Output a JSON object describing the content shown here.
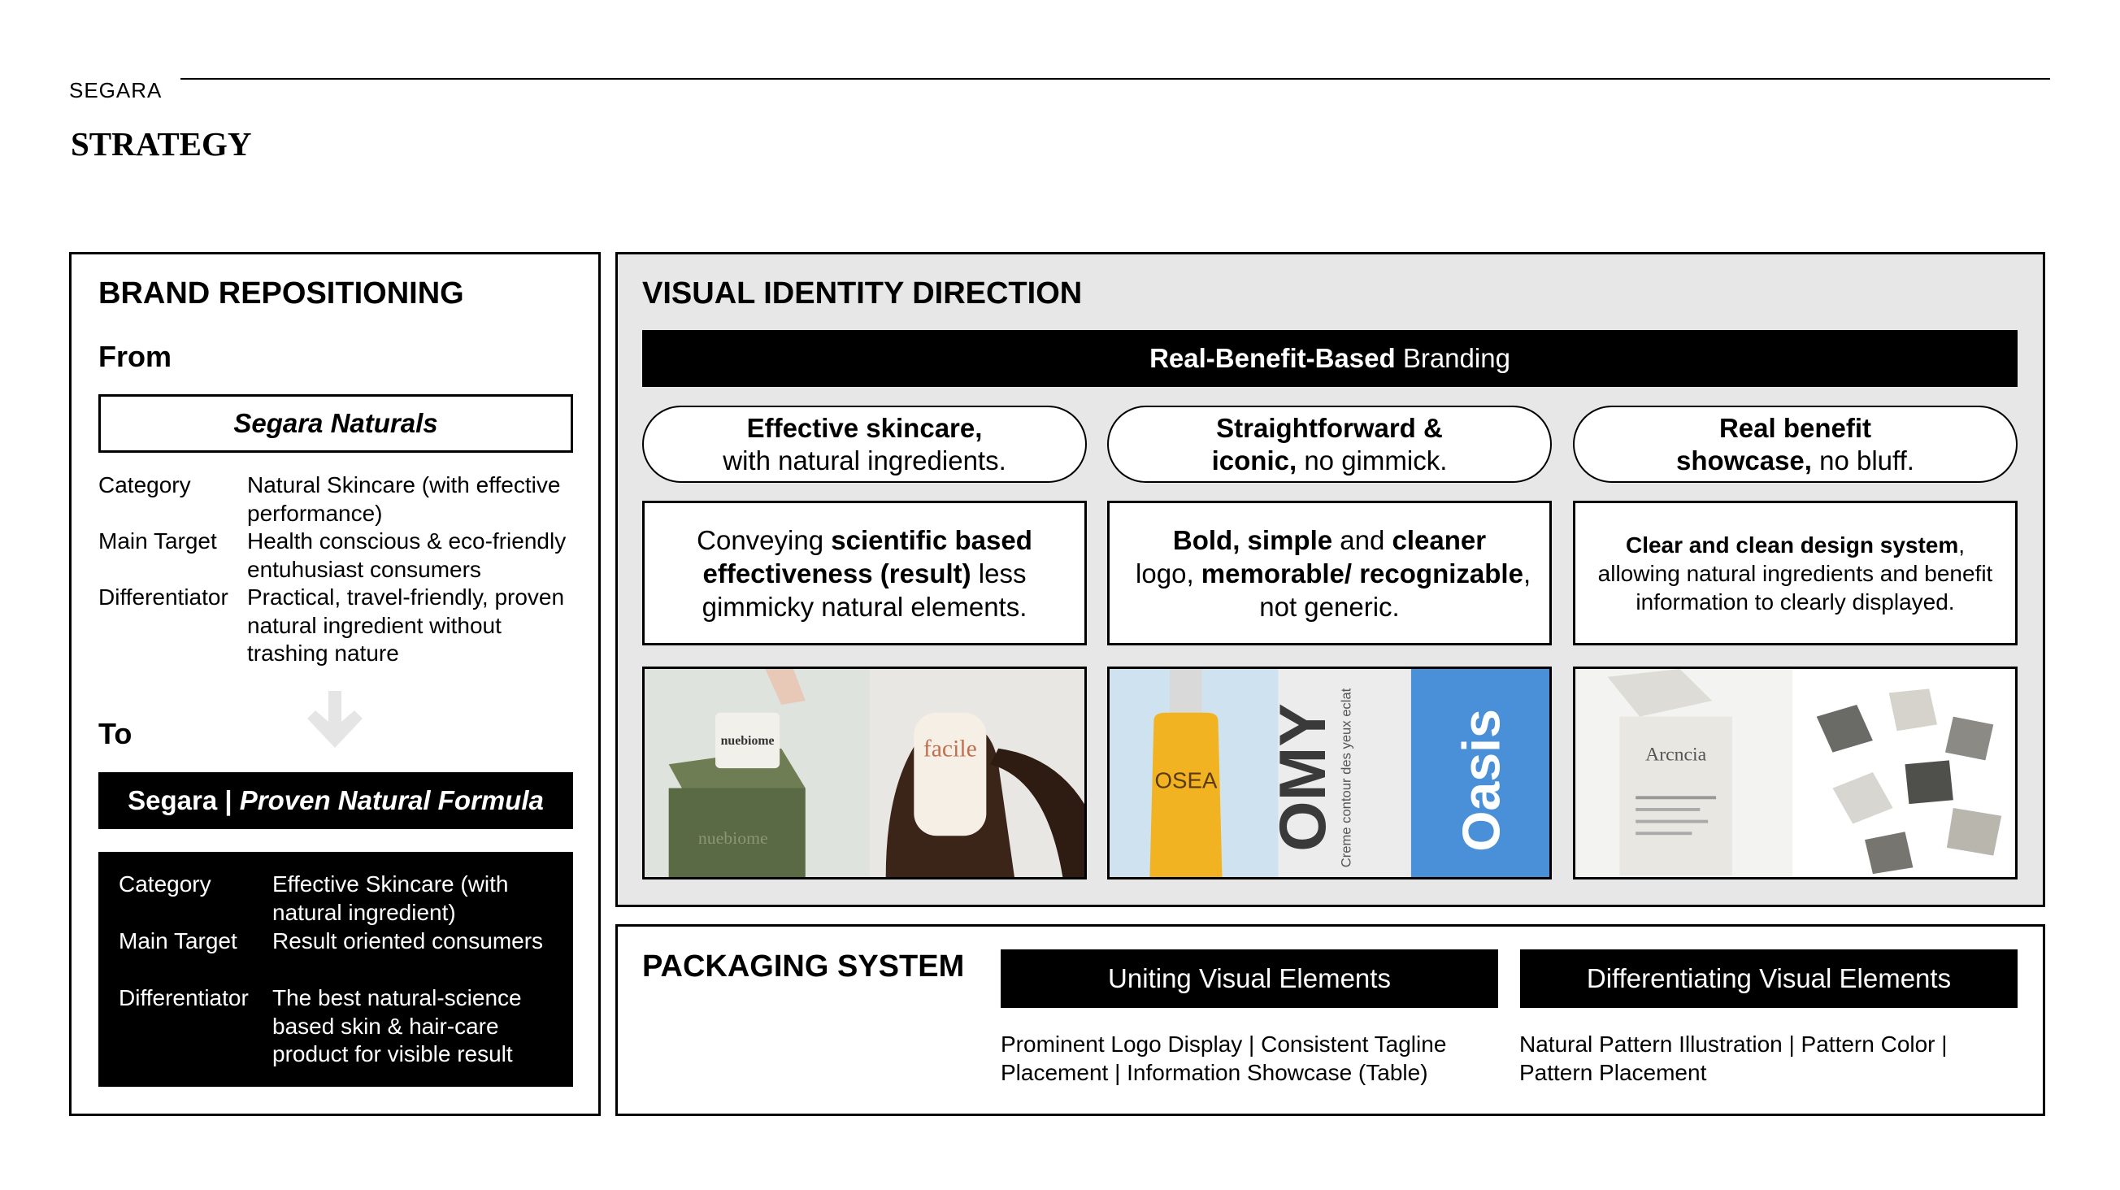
{
  "header": {
    "brand": "SEGARA",
    "title": "STRATEGY"
  },
  "repositioning": {
    "heading": "BRAND REPOSITIONING",
    "from_label": "From",
    "from_name": "Segara Naturals",
    "from_rows": [
      {
        "label": "Category",
        "value": "Natural Skincare (with effective performance)"
      },
      {
        "label": "Main Target",
        "value": "Health conscious & eco-friendly entuhusiast consumers"
      },
      {
        "label": "Differentiator",
        "value": "Practical, travel-friendly, proven natural ingredient without trashing nature"
      }
    ],
    "to_label": "To",
    "to_name_a": "Segara | ",
    "to_name_b": "Proven Natural Formula",
    "to_rows": [
      {
        "label": "Category",
        "value": "Effective Skincare (with natural ingredient)"
      },
      {
        "label": "Main Target",
        "value": "Result oriented consumers"
      },
      {
        "label": "Differentiator",
        "value": "The best natural-science based skin & hair-care product for visible result"
      }
    ]
  },
  "visual_identity": {
    "heading": "VISUAL IDENTITY DIRECTION",
    "bar_bold": "Real-Benefit-Based",
    "bar_regular": " Branding",
    "pillars": [
      {
        "line1": "Effective skincare,",
        "line2": "with natural ingredients."
      },
      {
        "line1": "Straightforward &",
        "line2_bold": "iconic,",
        "line2_rest": " no gimmick."
      },
      {
        "line1": "Real benefit",
        "line2_bold": "showcase,",
        "line2_rest": " no bluff."
      }
    ],
    "descriptions": [
      {
        "p1": "Conveying ",
        "b1": "scientific based effectiveness (result)",
        "p2": " less gimmicky natural elements."
      },
      {
        "b1": "Bold, simple",
        "p1": " and ",
        "b2": "cleaner",
        "p2": " logo, ",
        "b3": "memorable/ recognizable",
        "p3": ", not generic."
      },
      {
        "b1": "Clear and clean design system",
        "p1": ", allowing natural ingredients and benefit information to clearly displayed."
      }
    ],
    "image_labels": {
      "img1_box": "nuebiome",
      "img1_box2": "nuebiome",
      "img1_bottle": "facile",
      "img2_bottle": "OSEA",
      "img2_panel": "OMY",
      "img2_panel_side": "Creme contour des yeux eclat",
      "img2_logo": "Oasis",
      "img3_box": "Arcncia"
    }
  },
  "packaging": {
    "heading": "PACKAGING SYSTEM",
    "uniting_label": "Uniting Visual Elements",
    "uniting_text_1": "Prominent Logo Display | Consistent Tagline",
    "uniting_text_2": "Placement | Information Showcase (Table)",
    "diff_label": "Differentiating Visual Elements",
    "diff_text_1": "Natural Pattern Illustration | Pattern Color |",
    "diff_text_2": "Pattern Placement"
  }
}
